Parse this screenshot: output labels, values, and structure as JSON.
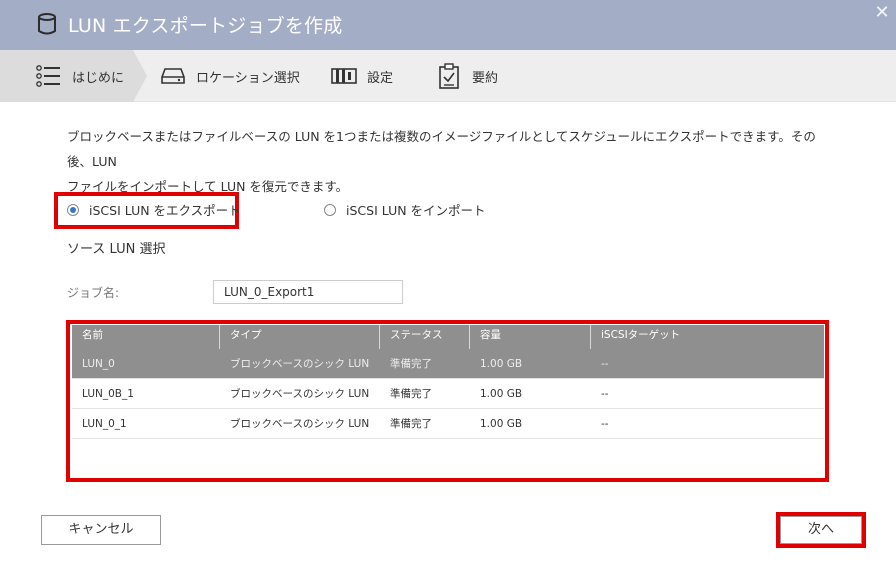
{
  "window": {
    "title": "LUN エクスポートジョブを作成",
    "close_glyph": "✕"
  },
  "steps": [
    {
      "label": "はじめに",
      "icon": "list-icon",
      "active": true
    },
    {
      "label": "ロケーション選択",
      "icon": "drive-icon",
      "active": false
    },
    {
      "label": "設定",
      "icon": "settings-panel-icon",
      "active": false
    },
    {
      "label": "要約",
      "icon": "clipboard-check-icon",
      "active": false
    }
  ],
  "description": {
    "line1": "ブロックベースまたはファイルベースの LUN を1つまたは複数のイメージファイルとしてスケジュールにエクスポートできます。その後、LUN",
    "line2": "ファイルをインポートして LUN を復元できます。"
  },
  "options": {
    "export_label": "iSCSI LUN をエクスポート",
    "import_label": "iSCSI LUN をインポート",
    "selected": "export"
  },
  "source": {
    "section_title": "ソース LUN 選択",
    "job_name_label": "ジョブ名:",
    "job_name_value": "LUN_0_Export1"
  },
  "table": {
    "columns": [
      "名前",
      "タイプ",
      "ステータス",
      "容量",
      "iSCSIターゲット"
    ],
    "rows": [
      {
        "name": "LUN_0",
        "type": "ブロックベースのシック LUN",
        "status": "準備完了",
        "capacity": "1.00 GB",
        "target": "--",
        "selected": true
      },
      {
        "name": "LUN_0B_1",
        "type": "ブロックベースのシック LUN",
        "status": "準備完了",
        "capacity": "1.00 GB",
        "target": "--",
        "selected": false
      },
      {
        "name": "LUN_0_1",
        "type": "ブロックベースのシック LUN",
        "status": "準備完了",
        "capacity": "1.00 GB",
        "target": "--",
        "selected": false
      }
    ]
  },
  "buttons": {
    "cancel": "キャンセル",
    "next": "次へ"
  },
  "colors": {
    "titlebar": "#a4adc6",
    "highlight": "#e10000",
    "selected_row": "#8f8f8f",
    "radio_accent": "#3579c4"
  }
}
